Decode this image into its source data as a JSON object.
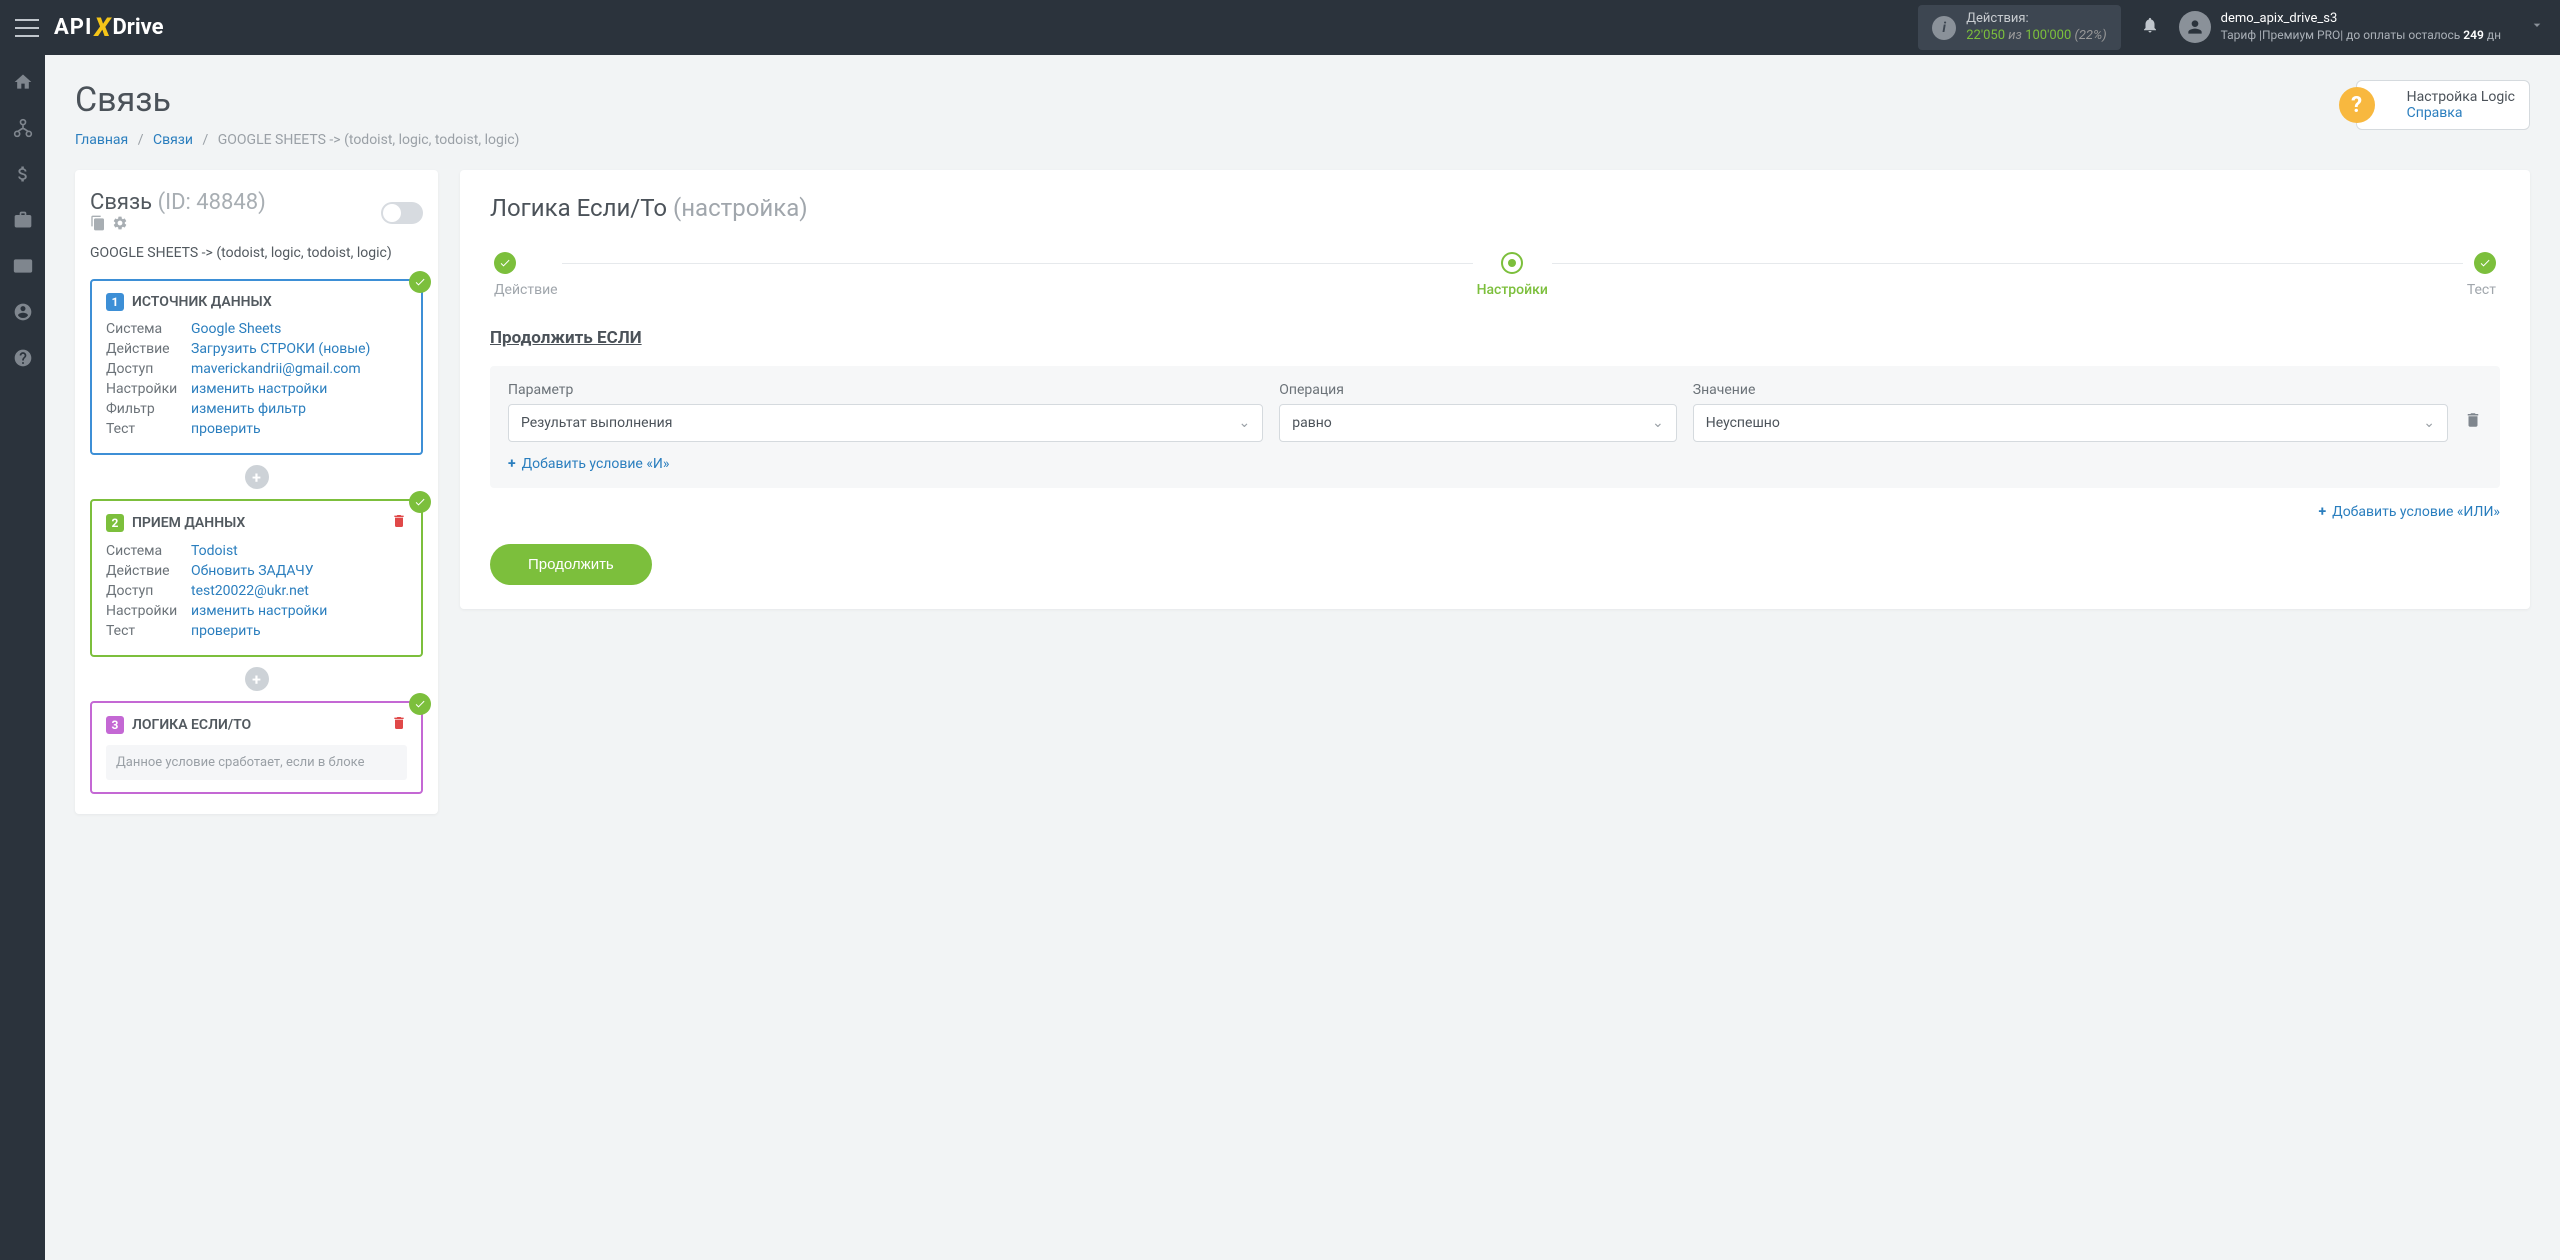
{
  "header": {
    "logo_api": "API",
    "logo_drive": "Drive",
    "actions_label": "Действия:",
    "used": "22'050",
    "of": "из",
    "total": "100'000",
    "pct": "(22%)",
    "user_name": "demo_apix_drive_s3",
    "tariff_prefix": "Тариф |Премиум PRO| до оплаты осталось ",
    "tariff_days": "249",
    "tariff_suffix": " дн"
  },
  "help": {
    "title": "Настройка Logic",
    "link": "Справка"
  },
  "page": {
    "title": "Связь"
  },
  "breadcrumb": {
    "home": "Главная",
    "links": "Связи",
    "current": "GOOGLE SHEETS -> (todoist, logic, todoist, logic)"
  },
  "left": {
    "link_label": "Связь",
    "link_id": "(ID: 48848)",
    "subtitle": "GOOGLE SHEETS -> (todoist, logic, todoist, logic)",
    "block1": {
      "num": "1",
      "title": "ИСТОЧНИК ДАННЫХ",
      "rows": {
        "system_k": "Система",
        "system_v": "Google Sheets",
        "action_k": "Действие",
        "action_v": "Загрузить СТРОКИ (новые)",
        "access_k": "Доступ",
        "access_v": "maverickandrii@gmail.com",
        "settings_k": "Настройки",
        "settings_v": "изменить настройки",
        "filter_k": "Фильтр",
        "filter_v": "изменить фильтр",
        "test_k": "Тест",
        "test_v": "проверить"
      }
    },
    "block2": {
      "num": "2",
      "title": "ПРИЕМ ДАННЫХ",
      "rows": {
        "system_k": "Система",
        "system_v": "Todoist",
        "action_k": "Действие",
        "action_v": "Обновить ЗАДАЧУ",
        "access_k": "Доступ",
        "access_v": "test20022@ukr.net",
        "settings_k": "Настройки",
        "settings_v": "изменить настройки",
        "test_k": "Тест",
        "test_v": "проверить"
      }
    },
    "block3": {
      "num": "3",
      "title": "ЛОГИКА ЕСЛИ/ТО",
      "note": "Данное условие сработает, если в блоке"
    }
  },
  "right": {
    "title": "Логика Если/То",
    "title_sub": "(настройка)",
    "steps": {
      "s1": "Действие",
      "s2": "Настройки",
      "s3": "Тест"
    },
    "section": "Продолжить ЕСЛИ",
    "param_label": "Параметр",
    "op_label": "Операция",
    "val_label": "Значение",
    "param_value": "Результат выполнения",
    "op_value": "равно",
    "val_value": "Неуспешно",
    "add_and": "Добавить условие «И»",
    "add_or": "Добавить условие «ИЛИ»",
    "continue": "Продолжить"
  }
}
